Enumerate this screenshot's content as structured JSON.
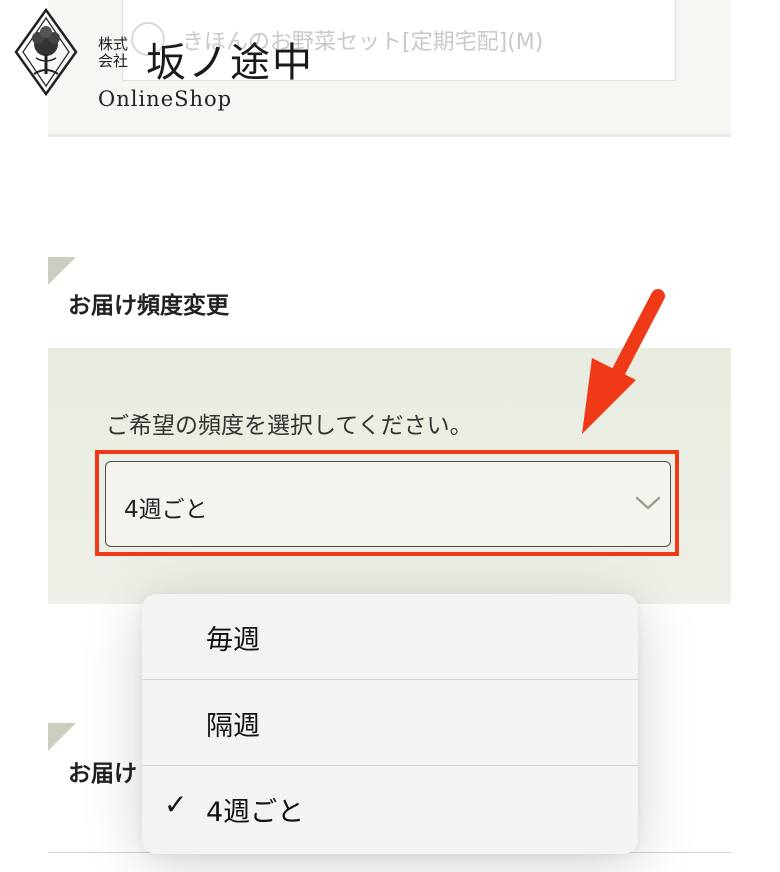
{
  "logo": {
    "kabushiki": "株式会社",
    "name": "坂ノ途中",
    "sub": "OnlineShop"
  },
  "product": {
    "label": "きほんのお野菜セット[定期宅配](M)"
  },
  "frequency_section": {
    "title": "お届け頻度変更",
    "prompt": "ご希望の頻度を選択してください。",
    "selected_value": "4週ごと"
  },
  "second_section": {
    "title_visible": "お届け"
  },
  "dropdown": {
    "options": [
      {
        "label": "毎週",
        "checked": false
      },
      {
        "label": "隔週",
        "checked": false
      },
      {
        "label": "4週ごと",
        "checked": true
      }
    ],
    "check_glyph": "✓"
  },
  "annotation": {
    "arrow_color": "#f03a17",
    "highlight_color": "#f03a17"
  },
  "colors": {
    "panel_bg": "#e8ecdf",
    "corner_accent": "#c9d0c0"
  }
}
